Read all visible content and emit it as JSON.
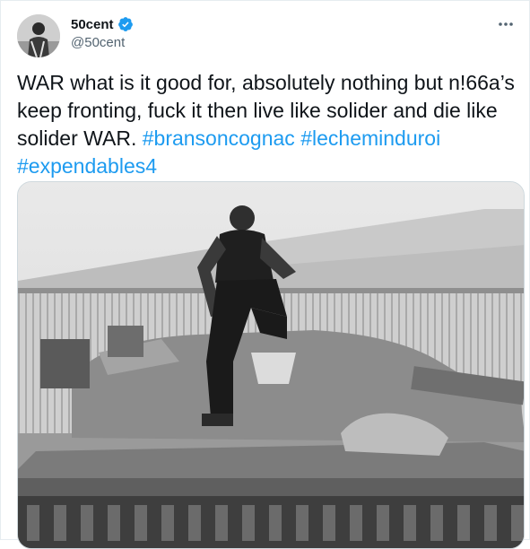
{
  "user": {
    "display_name": "50cent",
    "handle": "@50cent",
    "verified": true,
    "avatar_icon": "user-avatar"
  },
  "tweet": {
    "text_plain": "WAR what is it good for, absolutely nothing but n!66a’s keep fronting, fuck it then live like solider and die like solider WAR.",
    "hashtags": [
      "#bransoncognac",
      "#lecheminduroi",
      "#expendables4"
    ]
  },
  "more_icon": "more-horizontal-icon",
  "colors": {
    "link": "#1d9bf0",
    "verified": "#1d9bf0",
    "text": "#0f1419",
    "secondary": "#536471"
  }
}
